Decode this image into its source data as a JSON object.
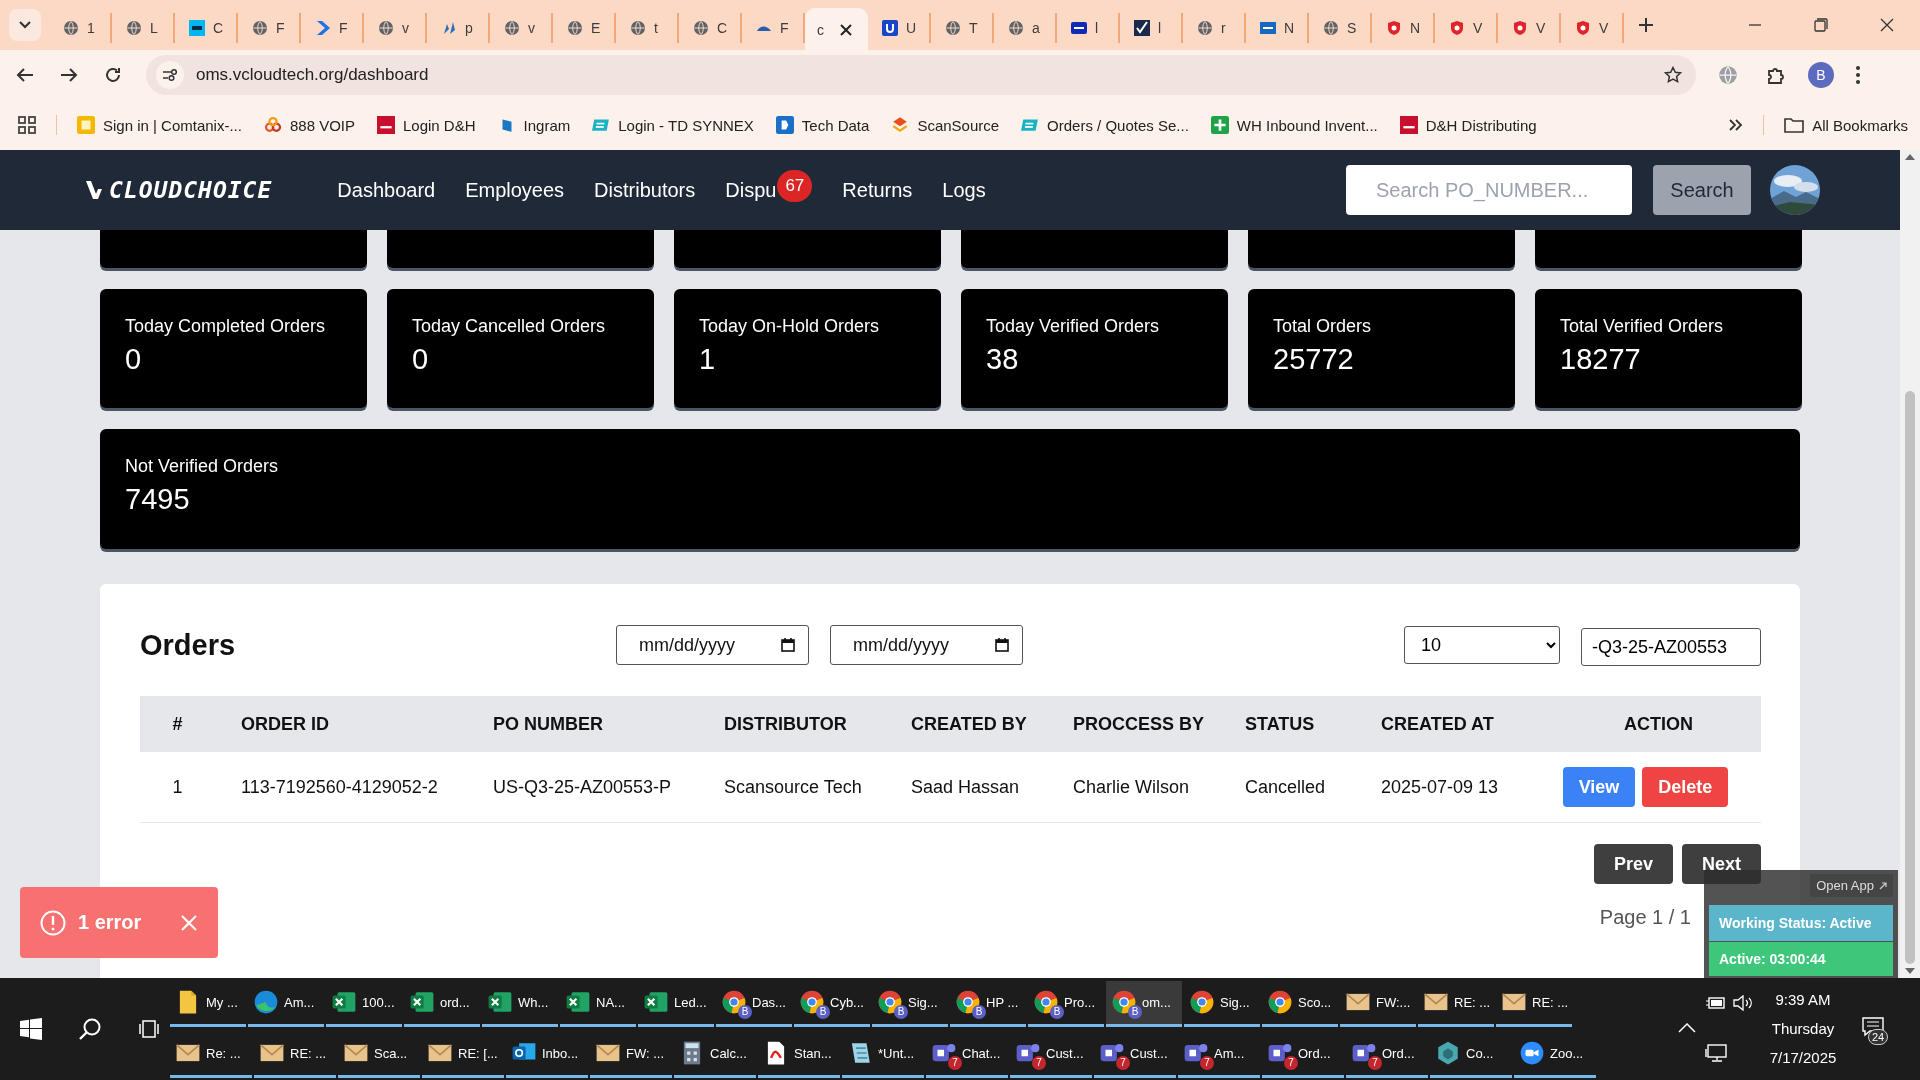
{
  "browser": {
    "tabs": [
      {
        "label": "1",
        "kind": "globe",
        "selected": false
      },
      {
        "label": "L",
        "kind": "globe",
        "selected": false
      },
      {
        "label": "C",
        "kind": "logi",
        "selected": false
      },
      {
        "label": "F",
        "kind": "globe",
        "selected": false
      },
      {
        "label": "F",
        "kind": "chevron",
        "selected": false
      },
      {
        "label": "v",
        "kind": "globe",
        "selected": false
      },
      {
        "label": "p",
        "kind": "figures",
        "selected": false
      },
      {
        "label": "v",
        "kind": "globe",
        "selected": false
      },
      {
        "label": "E",
        "kind": "globe",
        "selected": false
      },
      {
        "label": "t",
        "kind": "globe",
        "selected": false
      },
      {
        "label": "C",
        "kind": "globe",
        "selected": false
      },
      {
        "label": "F",
        "kind": "shark",
        "selected": false
      },
      {
        "label": "c",
        "kind": "none",
        "selected": true
      },
      {
        "label": "U",
        "kind": "u",
        "selected": false
      },
      {
        "label": "T",
        "kind": "globe",
        "selected": false
      },
      {
        "label": "a",
        "kind": "globe",
        "selected": false
      },
      {
        "label": "l",
        "kind": "brother",
        "selected": false
      },
      {
        "label": "l",
        "kind": "check",
        "selected": false
      },
      {
        "label": "r",
        "kind": "globe",
        "selected": false
      },
      {
        "label": "N",
        "kind": "etn",
        "selected": false
      },
      {
        "label": "S",
        "kind": "globe",
        "selected": false
      },
      {
        "label": "N",
        "kind": "shield",
        "selected": false
      },
      {
        "label": "V",
        "kind": "shield",
        "selected": false
      },
      {
        "label": "V",
        "kind": "shield",
        "selected": false
      },
      {
        "label": "V",
        "kind": "shield",
        "selected": false
      }
    ],
    "address": "oms.vcloudtech.org/dashboard",
    "profile": "B",
    "bookmarks": [
      {
        "label": "Sign in | Comtanix-...",
        "kind": "wtile"
      },
      {
        "label": "888 VOIP",
        "kind": "rings"
      },
      {
        "label": "Login D&H",
        "kind": "dh"
      },
      {
        "label": "Ingram",
        "kind": "ingram"
      },
      {
        "label": "Login - TD SYNNEX",
        "kind": "ec"
      },
      {
        "label": "Tech Data",
        "kind": "techdata"
      },
      {
        "label": "ScanSource",
        "kind": "scan"
      },
      {
        "label": "Orders / Quotes Se...",
        "kind": "ec"
      },
      {
        "label": "WH Inbound Invent...",
        "kind": "plus"
      },
      {
        "label": "D&H Distributing",
        "kind": "dh"
      }
    ],
    "all_bookmarks": "All Bookmarks"
  },
  "navbar": {
    "logo_text": "CLOUDCHOICE",
    "links": [
      {
        "label": "Dashboard"
      },
      {
        "label": "Employees"
      },
      {
        "label": "Distributors"
      },
      {
        "label": "Dispu",
        "badge": "67"
      },
      {
        "label": "Returns"
      },
      {
        "label": "Logs"
      }
    ],
    "search": {
      "placeholder": "Search PO_NUMBER..."
    },
    "search_button": "Search"
  },
  "stats": [
    {
      "label": "Today Completed Orders",
      "value": "0"
    },
    {
      "label": "Today Cancelled Orders",
      "value": "0"
    },
    {
      "label": "Today On-Hold Orders",
      "value": "1"
    },
    {
      "label": "Today Verified Orders",
      "value": "38"
    },
    {
      "label": "Total Orders",
      "value": "25772"
    },
    {
      "label": "Total Verified Orders",
      "value": "18277"
    }
  ],
  "not_verified": {
    "label": "Not Verified Orders",
    "value": "7495"
  },
  "orders": {
    "title": "Orders",
    "date_from": {
      "placeholder": "mm/dd/yyyy"
    },
    "date_to": {
      "placeholder": "mm/dd/yyyy"
    },
    "page_size": "10",
    "search": {
      "value": "-Q3-25-AZ00553"
    },
    "columns": [
      "#",
      "ORDER ID",
      "PO NUMBER",
      "DISTRIBUTOR",
      "CREATED BY",
      "PROCCESS BY",
      "STATUS",
      "CREATED AT",
      "ACTION"
    ],
    "rows": [
      {
        "cells": [
          "1",
          "113-7192560-4129052-2",
          "US-Q3-25-AZ00553-P",
          "Scansource Tech",
          "Saad Hassan",
          "Charlie Wilson",
          "Cancelled",
          "2025-07-09 13"
        ],
        "actions": [
          "View",
          "Delete"
        ]
      }
    ],
    "prev": "Prev",
    "next": "Next",
    "page_info": "Page 1 / 1"
  },
  "toast": {
    "message": "1 error"
  },
  "widget": {
    "open_app": "Open App",
    "working_status": "Working Status: Active",
    "active_time": "Active: 03:00:44"
  },
  "taskbar": {
    "row_1": [
      {
        "label": "My ...",
        "kind": "folder",
        "selected": false
      },
      {
        "label": "Am...",
        "kind": "edge",
        "selected": false
      },
      {
        "label": "100...",
        "kind": "excel",
        "selected": false
      },
      {
        "label": "ord...",
        "kind": "excel",
        "selected": false
      },
      {
        "label": "Wh...",
        "kind": "excel",
        "selected": false
      },
      {
        "label": "NA...",
        "kind": "excel",
        "selected": false
      },
      {
        "label": "Led...",
        "kind": "excel",
        "selected": false
      },
      {
        "label": "Das...",
        "kind": "chrome",
        "badge": "B",
        "selected": false
      },
      {
        "label": "Cyb...",
        "kind": "chrome",
        "badge": "B",
        "selected": false
      },
      {
        "label": "Sig...",
        "kind": "chrome",
        "badge": "B",
        "selected": false
      },
      {
        "label": "HP ...",
        "kind": "chrome",
        "badge": "B",
        "selected": false
      },
      {
        "label": "Pro...",
        "kind": "chrome",
        "badge": "B",
        "selected": false
      },
      {
        "label": "om...",
        "kind": "chrome",
        "badge": "B",
        "selected": true
      },
      {
        "label": "Sig...",
        "kind": "chrome",
        "selected": false
      },
      {
        "label": "Sco...",
        "kind": "chrome",
        "selected": false
      },
      {
        "label": "FW:...",
        "kind": "mail",
        "selected": false
      },
      {
        "label": "RE: ...",
        "kind": "mail",
        "selected": false
      },
      {
        "label": "RE: ...",
        "kind": "mail",
        "selected": false
      }
    ],
    "row_2": [
      {
        "label": "Re: ...",
        "kind": "mail",
        "selected": false
      },
      {
        "label": "RE: ...",
        "kind": "mail",
        "selected": false
      },
      {
        "label": "Sca...",
        "kind": "mail",
        "selected": false
      },
      {
        "label": "RE: [...",
        "kind": "mail",
        "selected": false
      },
      {
        "label": "Inbo...",
        "kind": "outlook",
        "selected": false
      },
      {
        "label": "FW: ...",
        "kind": "mail",
        "selected": false
      },
      {
        "label": "Calc...",
        "kind": "calc",
        "selected": false
      },
      {
        "label": "Stan...",
        "kind": "pdf",
        "selected": false
      },
      {
        "label": "*Unt...",
        "kind": "notepad",
        "selected": false
      },
      {
        "label": "Chat...",
        "kind": "teams",
        "badge": "7",
        "selected": false
      },
      {
        "label": "Cust...",
        "kind": "teams",
        "badge": "7",
        "selected": false
      },
      {
        "label": "Cust...",
        "kind": "teams",
        "badge": "7",
        "selected": false
      },
      {
        "label": "Am...",
        "kind": "teams",
        "badge": "7",
        "selected": false
      },
      {
        "label": "Ord...",
        "kind": "teams",
        "badge": "7",
        "selected": false
      },
      {
        "label": "Ord...",
        "kind": "teams",
        "badge": "7",
        "selected": false
      },
      {
        "label": "Co...",
        "kind": "box",
        "selected": false
      },
      {
        "label": "Zoo...",
        "kind": "zoom",
        "selected": false
      }
    ],
    "tray": {
      "time": "9:39 AM",
      "day": "Thursday",
      "date": "7/17/2025",
      "notifications": "24"
    }
  }
}
